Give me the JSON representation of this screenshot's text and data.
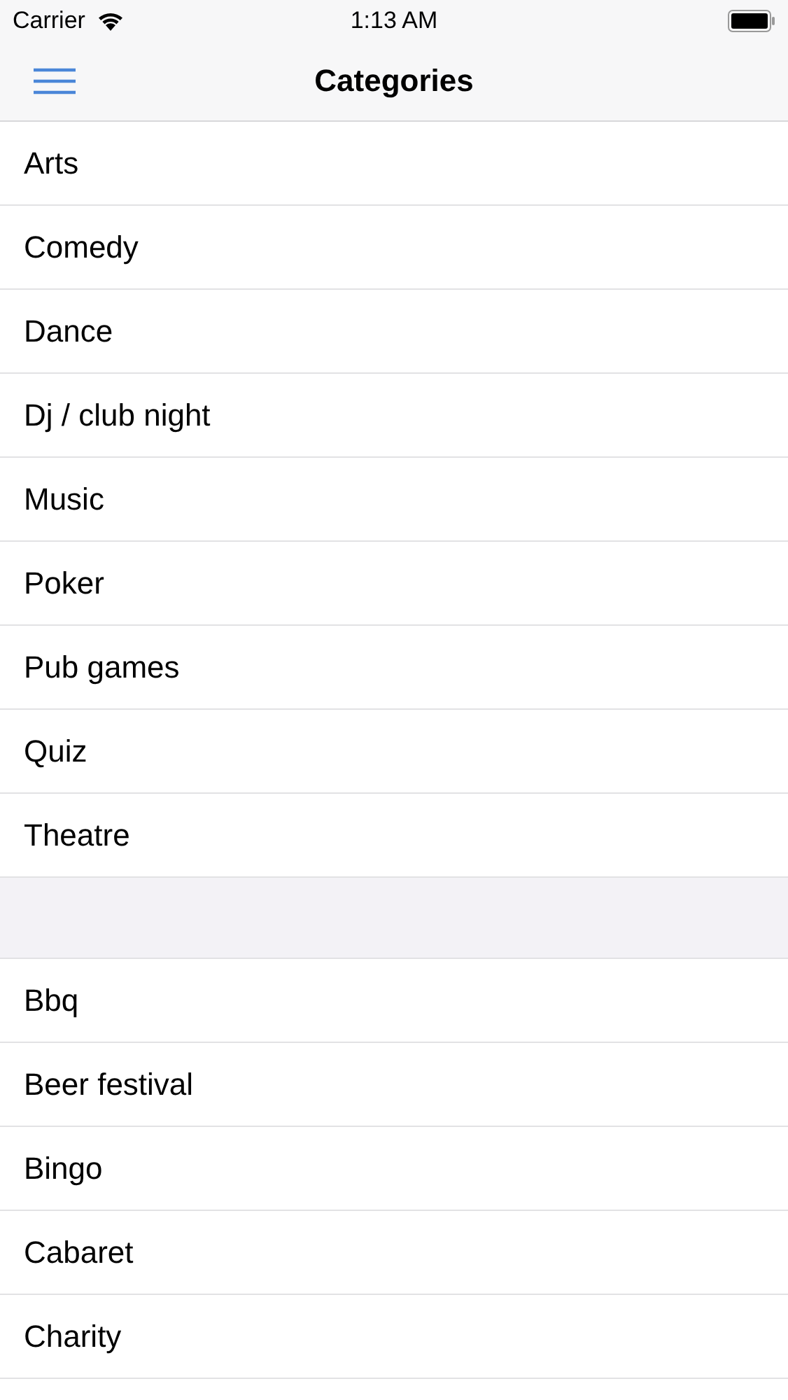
{
  "status_bar": {
    "carrier": "Carrier",
    "time": "1:13 AM"
  },
  "nav_bar": {
    "title": "Categories"
  },
  "sections": [
    {
      "items": [
        "Arts",
        "Comedy",
        "Dance",
        "Dj / club night",
        "Music",
        "Poker",
        "Pub games",
        "Quiz",
        "Theatre"
      ]
    },
    {
      "items": [
        "Bbq",
        "Beer festival",
        "Bingo",
        "Cabaret",
        "Charity"
      ]
    }
  ]
}
